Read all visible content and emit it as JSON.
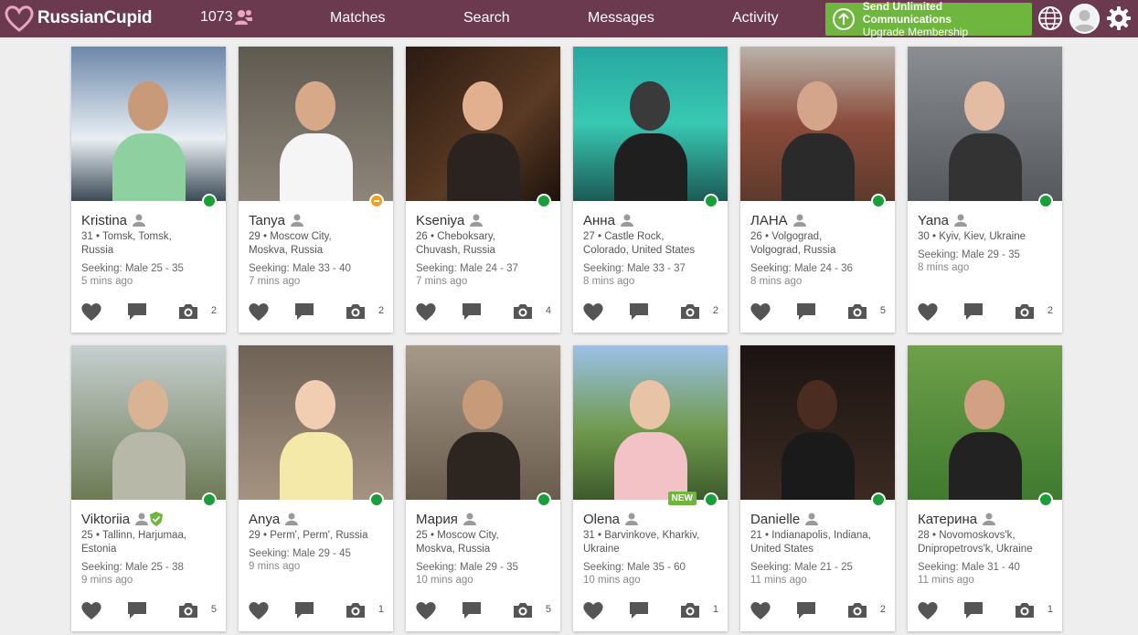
{
  "header": {
    "logo_text": "RussianCupid",
    "counter": "1073",
    "nav": [
      "Matches",
      "Search",
      "Messages",
      "Activity"
    ],
    "upgrade_line1": "Send Unlimited Communications",
    "upgrade_line2": "Upgrade Membership"
  },
  "profiles": [
    {
      "name": "Kristina",
      "loc1": "31 • Tomsk, Tomsk,",
      "loc2": "Russia",
      "seeking": "Seeking: Male 25 - 35",
      "ago": "5 mins ago",
      "photos": "2",
      "status": "online"
    },
    {
      "name": "Tanya",
      "loc1": "29 • Moscow City,",
      "loc2": "Moskva, Russia",
      "seeking": "Seeking: Male 33 - 40",
      "ago": "7 mins ago",
      "photos": "2",
      "status": "away"
    },
    {
      "name": "Kseniya",
      "loc1": "26 • Cheboksary,",
      "loc2": "Chuvash, Russia",
      "seeking": "Seeking: Male 24 - 37",
      "ago": "7 mins ago",
      "photos": "4",
      "status": "online"
    },
    {
      "name": "Анна",
      "loc1": "27 • Castle Rock,",
      "loc2": "Colorado, United States",
      "seeking": "Seeking: Male 33 - 37",
      "ago": "8 mins ago",
      "photos": "2",
      "status": "online"
    },
    {
      "name": "ЛАНА",
      "loc1": "26 • Volgograd,",
      "loc2": "Volgograd, Russia",
      "seeking": "Seeking: Male 24 - 36",
      "ago": "8 mins ago",
      "photos": "5",
      "status": "online"
    },
    {
      "name": "Yana",
      "loc1": "30 • Kyiv, Kiev, Ukraine",
      "loc2": "",
      "seeking": "Seeking: Male 29 - 35",
      "ago": "8 mins ago",
      "photos": "2",
      "status": "online"
    },
    {
      "name": "Viktoriia",
      "loc1": "25 • Tallinn, Harjumaa,",
      "loc2": "Estonia",
      "seeking": "Seeking: Male 25 - 38",
      "ago": "9 mins ago",
      "photos": "5",
      "status": "online",
      "verified": true
    },
    {
      "name": "Anya",
      "loc1": "29 • Perm', Perm', Russia",
      "loc2": "",
      "seeking": "Seeking: Male 29 - 45",
      "ago": "9 mins ago",
      "photos": "1",
      "status": "online"
    },
    {
      "name": "Мария",
      "loc1": "25 • Moscow City,",
      "loc2": "Moskva, Russia",
      "seeking": "Seeking: Male 29 - 35",
      "ago": "10 mins ago",
      "photos": "5",
      "status": "online"
    },
    {
      "name": "Olena",
      "loc1": "31 • Barvinkove, Kharkiv,",
      "loc2": "Ukraine",
      "seeking": "Seeking: Male 35 - 60",
      "ago": "10 mins ago",
      "photos": "1",
      "status": "online",
      "new_label": "NEW"
    },
    {
      "name": "Danielle",
      "loc1": "21 • Indianapolis, Indiana,",
      "loc2": "United States",
      "seeking": "Seeking: Male 21 - 25",
      "ago": "11 mins ago",
      "photos": "2",
      "status": "online"
    },
    {
      "name": "Катерина",
      "loc1": "28 • Novomoskovs'k,",
      "loc2": "Dnipropetrovs'k, Ukraine",
      "seeking": "Seeking: Male 31 - 40",
      "ago": "11 mins ago",
      "photos": "1",
      "status": "online"
    }
  ],
  "colors": {
    "header": "#6b3a4f",
    "accent": "#6fb63e",
    "online": "#1a9e3a",
    "away": "#f0a020"
  },
  "icons": [
    "heart-logo-icon",
    "people-icon",
    "upload-arrow-icon",
    "globe-icon",
    "avatar-icon",
    "gear-icon",
    "person-icon",
    "verified-shield-icon",
    "like-heart-icon",
    "chat-icon",
    "camera-icon"
  ]
}
